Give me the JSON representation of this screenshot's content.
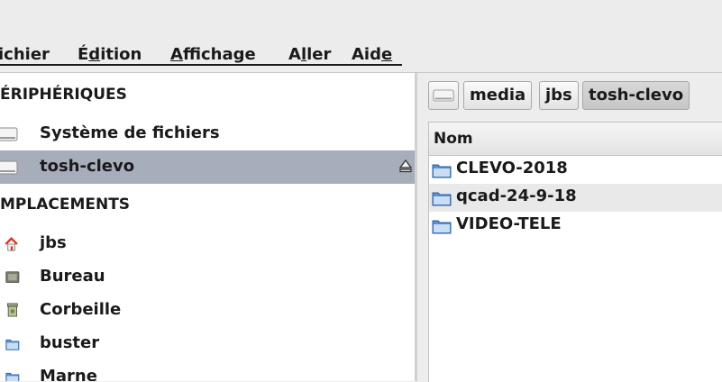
{
  "menu": {
    "items": [
      {
        "label": "ichier",
        "mnemonic": ""
      },
      {
        "pre": "É",
        "mnemonic": "d",
        "post": "ition"
      },
      {
        "pre": "",
        "mnemonic": "A",
        "post": "ffichage"
      },
      {
        "pre": "A",
        "mnemonic": "l",
        "post": "ler"
      },
      {
        "pre": "Aid",
        "mnemonic": "e",
        "post": ""
      }
    ]
  },
  "sidebar": {
    "devices_header": "ÉRIPHÉRIQUES",
    "devices": [
      {
        "label": "Système de fichiers",
        "icon": "drive-icon"
      },
      {
        "label": "tosh-clevo",
        "icon": "drive-icon",
        "selected": true,
        "eject": true
      }
    ],
    "places_header": "MPLACEMENTS",
    "places": [
      {
        "label": "jbs",
        "icon": "home-icon"
      },
      {
        "label": "Bureau",
        "icon": "desktop-icon"
      },
      {
        "label": "Corbeille",
        "icon": "trash-icon"
      },
      {
        "label": "buster",
        "icon": "folder-icon"
      },
      {
        "label": "Marne",
        "icon": "folder-icon"
      }
    ]
  },
  "pathbar": {
    "crumbs": [
      "media",
      "jbs",
      "tosh-clevo"
    ],
    "active": "tosh-clevo"
  },
  "filelist": {
    "column_name": "Nom",
    "files": [
      "CLEVO-2018",
      "qcad-24-9-18",
      "VIDEO-TELE"
    ]
  },
  "colors": {
    "selection": "#a8adbb",
    "folder": "#5a8fd0",
    "home_roof": "#d9342b"
  }
}
